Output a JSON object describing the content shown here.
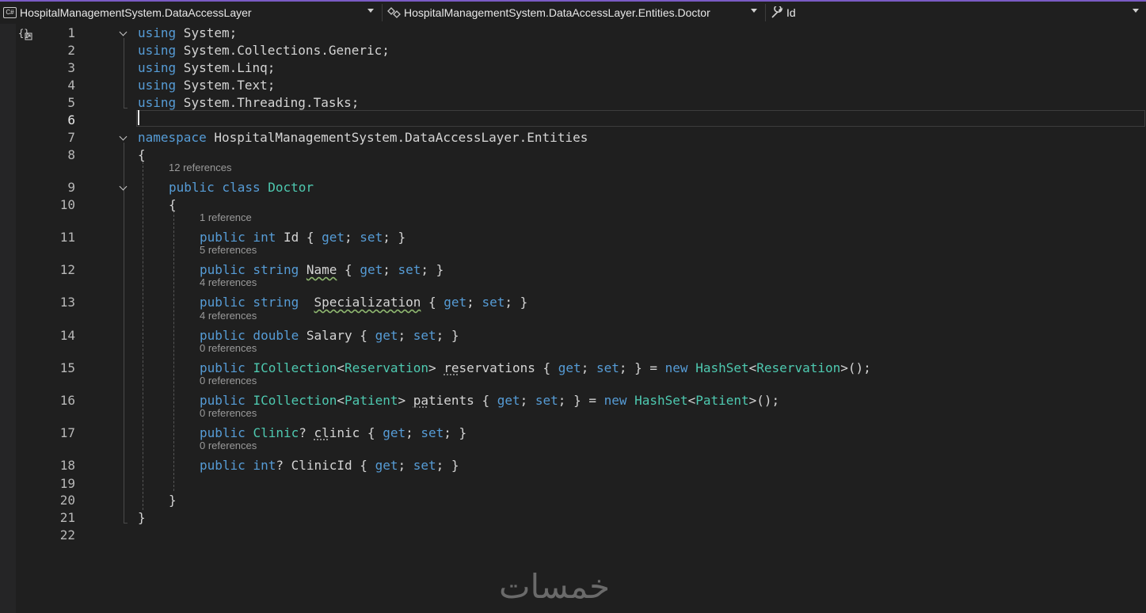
{
  "nav": {
    "project": "HospitalManagementSystem.DataAccessLayer",
    "type": "HospitalManagementSystem.DataAccessLayer.Entities.Doctor",
    "member": "Id",
    "project_icon": "C#"
  },
  "editor": {
    "current_line": 6,
    "lines": [
      {
        "n": "1",
        "tokens": [
          {
            "t": "using",
            "c": "kw"
          },
          {
            "t": " System;",
            "c": "pl"
          }
        ]
      },
      {
        "n": "2",
        "tokens": [
          {
            "t": "using",
            "c": "kw"
          },
          {
            "t": " System.Collections.Generic;",
            "c": "pl"
          }
        ]
      },
      {
        "n": "3",
        "tokens": [
          {
            "t": "using",
            "c": "kw"
          },
          {
            "t": " System.Linq;",
            "c": "pl"
          }
        ]
      },
      {
        "n": "4",
        "tokens": [
          {
            "t": "using",
            "c": "kw"
          },
          {
            "t": " System.Text;",
            "c": "pl"
          }
        ]
      },
      {
        "n": "5",
        "tokens": [
          {
            "t": "using",
            "c": "kw"
          },
          {
            "t": " System.Threading.Tasks;",
            "c": "pl"
          }
        ]
      },
      {
        "n": "6",
        "tokens": []
      },
      {
        "n": "7",
        "tokens": [
          {
            "t": "namespace",
            "c": "kw"
          },
          {
            "t": " HospitalManagementSystem.DataAccessLayer.Entities",
            "c": "pl"
          }
        ]
      },
      {
        "n": "8",
        "tokens": [
          {
            "t": "{",
            "c": "pl"
          }
        ]
      },
      {
        "n": "9",
        "lens": "12 references",
        "tokens": [
          {
            "t": "public class",
            "c": "kw"
          },
          {
            "t": " ",
            "c": "pl"
          },
          {
            "t": "Doctor",
            "c": "ty"
          }
        ]
      },
      {
        "n": "10",
        "tokens": [
          {
            "t": "{",
            "c": "pl"
          }
        ]
      },
      {
        "n": "11",
        "lens": "1 reference",
        "tokens": [
          {
            "t": "public int",
            "c": "kw"
          },
          {
            "t": " Id { ",
            "c": "pl"
          },
          {
            "t": "get",
            "c": "kw"
          },
          {
            "t": "; ",
            "c": "pl"
          },
          {
            "t": "set",
            "c": "kw"
          },
          {
            "t": "; }",
            "c": "pl"
          }
        ]
      },
      {
        "n": "12",
        "lens": "5 references",
        "tokens": [
          {
            "t": "public string",
            "c": "kw"
          },
          {
            "t": " ",
            "c": "pl"
          },
          {
            "t": "Name",
            "c": "pl sq"
          },
          {
            "t": " { ",
            "c": "pl"
          },
          {
            "t": "get",
            "c": "kw"
          },
          {
            "t": "; ",
            "c": "pl"
          },
          {
            "t": "set",
            "c": "kw"
          },
          {
            "t": "; }",
            "c": "pl"
          }
        ]
      },
      {
        "n": "13",
        "lens": "4 references",
        "tokens": [
          {
            "t": "public string",
            "c": "kw"
          },
          {
            "t": "  ",
            "c": "pl"
          },
          {
            "t": "Specialization",
            "c": "pl sq"
          },
          {
            "t": " { ",
            "c": "pl"
          },
          {
            "t": "get",
            "c": "kw"
          },
          {
            "t": "; ",
            "c": "pl"
          },
          {
            "t": "set",
            "c": "kw"
          },
          {
            "t": "; }",
            "c": "pl"
          }
        ]
      },
      {
        "n": "14",
        "lens": "4 references",
        "tokens": [
          {
            "t": "public double",
            "c": "kw"
          },
          {
            "t": " Salary { ",
            "c": "pl"
          },
          {
            "t": "get",
            "c": "kw"
          },
          {
            "t": "; ",
            "c": "pl"
          },
          {
            "t": "set",
            "c": "kw"
          },
          {
            "t": "; }",
            "c": "pl"
          }
        ]
      },
      {
        "n": "15",
        "lens": "0 references",
        "tokens": [
          {
            "t": "public",
            "c": "kw"
          },
          {
            "t": " ",
            "c": "pl"
          },
          {
            "t": "ICollection",
            "c": "ty"
          },
          {
            "t": "<",
            "c": "pl"
          },
          {
            "t": "Reservation",
            "c": "ty"
          },
          {
            "t": "> ",
            "c": "pl"
          },
          {
            "t": "re",
            "c": "pl dot"
          },
          {
            "t": "servations { ",
            "c": "pl"
          },
          {
            "t": "get",
            "c": "kw"
          },
          {
            "t": "; ",
            "c": "pl"
          },
          {
            "t": "set",
            "c": "kw"
          },
          {
            "t": "; } = ",
            "c": "pl"
          },
          {
            "t": "new",
            "c": "kw"
          },
          {
            "t": " ",
            "c": "pl"
          },
          {
            "t": "HashSet",
            "c": "ty"
          },
          {
            "t": "<",
            "c": "pl"
          },
          {
            "t": "Reservation",
            "c": "ty"
          },
          {
            "t": ">();",
            "c": "pl"
          }
        ]
      },
      {
        "n": "16",
        "lens": "0 references",
        "tokens": [
          {
            "t": "public",
            "c": "kw"
          },
          {
            "t": " ",
            "c": "pl"
          },
          {
            "t": "ICollection",
            "c": "ty"
          },
          {
            "t": "<",
            "c": "pl"
          },
          {
            "t": "Patient",
            "c": "ty"
          },
          {
            "t": "> ",
            "c": "pl"
          },
          {
            "t": "pa",
            "c": "pl dot"
          },
          {
            "t": "tients { ",
            "c": "pl"
          },
          {
            "t": "get",
            "c": "kw"
          },
          {
            "t": "; ",
            "c": "pl"
          },
          {
            "t": "set",
            "c": "kw"
          },
          {
            "t": "; } = ",
            "c": "pl"
          },
          {
            "t": "new",
            "c": "kw"
          },
          {
            "t": " ",
            "c": "pl"
          },
          {
            "t": "HashSet",
            "c": "ty"
          },
          {
            "t": "<",
            "c": "pl"
          },
          {
            "t": "Patient",
            "c": "ty"
          },
          {
            "t": ">();",
            "c": "pl"
          }
        ]
      },
      {
        "n": "17",
        "lens": "0 references",
        "tokens": [
          {
            "t": "public",
            "c": "kw"
          },
          {
            "t": " ",
            "c": "pl"
          },
          {
            "t": "Clinic",
            "c": "ty"
          },
          {
            "t": "? ",
            "c": "pl"
          },
          {
            "t": "cl",
            "c": "pl dot"
          },
          {
            "t": "inic { ",
            "c": "pl"
          },
          {
            "t": "get",
            "c": "kw"
          },
          {
            "t": "; ",
            "c": "pl"
          },
          {
            "t": "set",
            "c": "kw"
          },
          {
            "t": "; }",
            "c": "pl"
          }
        ]
      },
      {
        "n": "18",
        "lens": "0 references",
        "tokens": [
          {
            "t": "public int",
            "c": "kw"
          },
          {
            "t": "? ClinicId { ",
            "c": "pl"
          },
          {
            "t": "get",
            "c": "kw"
          },
          {
            "t": "; ",
            "c": "pl"
          },
          {
            "t": "set",
            "c": "kw"
          },
          {
            "t": "; }",
            "c": "pl"
          }
        ]
      },
      {
        "n": "19",
        "tokens": []
      },
      {
        "n": "20",
        "tokens": [
          {
            "t": "}",
            "c": "pl"
          }
        ]
      },
      {
        "n": "21",
        "tokens": [
          {
            "t": "}",
            "c": "pl"
          }
        ]
      },
      {
        "n": "22",
        "tokens": []
      }
    ]
  },
  "watermark": "خمسات",
  "colors": {
    "keyword": "#569cd6",
    "type": "#4ec9b0",
    "text": "#d4d4d4",
    "accent": "#7a5bc4"
  },
  "icons": [
    "csharp-project-icon",
    "class-member-icon",
    "wrench-icon",
    "chevron-down-icon",
    "fold-chevron-icon",
    "format-braces-icon"
  ]
}
